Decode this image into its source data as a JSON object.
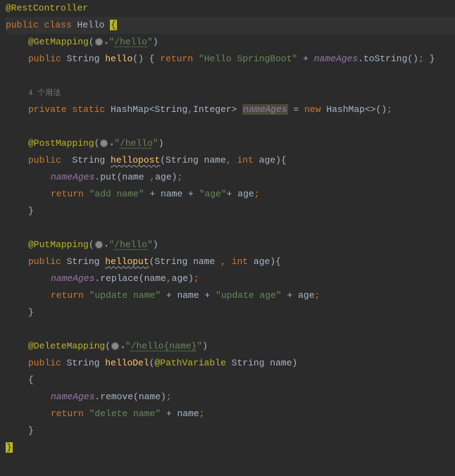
{
  "lines": {
    "l1": "@RestController",
    "l2a": "public",
    "l2b": "class",
    "l2c": "Hello",
    "l2d": "{",
    "l3a": "@GetMapping",
    "l3b": "(",
    "l3c": "\"",
    "l3d": "/hello",
    "l3e": "\"",
    "l3f": ")",
    "l4a": "public",
    "l4b": "String",
    "l4c": "hello",
    "l4d": "() { ",
    "l4e": "return",
    "l4f": "\"Hello SpringBoot\"",
    "l4g": " + ",
    "l4h": "nameAges",
    "l4i": ".toString()",
    "l4j": ";",
    "l4k": " }",
    "l5": "4 个用法",
    "l6a": "private",
    "l6b": "static",
    "l6c": "HashMap<String",
    "l6d": ",",
    "l6e": "Integer> ",
    "l6f": "nameAges",
    "l6g": " = ",
    "l6h": "new",
    "l6i": " HashMap<>()",
    "l6j": ";",
    "l7a": "@PostMapping",
    "l7b": "(",
    "l7c": "\"",
    "l7d": "/hello",
    "l7e": "\"",
    "l7f": ")",
    "l8a": "public",
    "l8b": "  String ",
    "l8c": "hellopost",
    "l8d": "(String name",
    "l8e": ",",
    "l8f": " ",
    "l8g": "int",
    "l8h": " age){",
    "l9a": "nameAges",
    "l9b": ".put(name ",
    "l9c": ",",
    "l9d": "age)",
    "l9e": ";",
    "l10a": "return",
    "l10b": "\"add name\"",
    "l10c": " + name + ",
    "l10d": "\"age\"",
    "l10e": "+ age",
    "l10f": ";",
    "l11": "}",
    "l12a": "@PutMapping",
    "l12b": "(",
    "l12c": "\"",
    "l12d": "/hello",
    "l12e": "\"",
    "l12f": ")",
    "l13a": "public",
    "l13b": " String ",
    "l13c": "helloput",
    "l13d": "(String name ",
    "l13e": ",",
    "l13f": " ",
    "l13g": "int",
    "l13h": " age){",
    "l14a": "nameAges",
    "l14b": ".replace(name",
    "l14c": ",",
    "l14d": "age)",
    "l14e": ";",
    "l15a": "return",
    "l15b": "\"update name\"",
    "l15c": " + name + ",
    "l15d": "\"update age\"",
    "l15e": " + age",
    "l15f": ";",
    "l16": "}",
    "l17a": "@DeleteMapping",
    "l17b": "(",
    "l17c": "\"",
    "l17d": "/hello{name}",
    "l17e": "\"",
    "l17f": ")",
    "l18a": "public",
    "l18b": " String ",
    "l18c": "helloDel",
    "l18d": "(",
    "l18e": "@PathVariable",
    "l18f": " String name)",
    "l19": "{",
    "l20a": "nameAges",
    "l20b": ".remove(name)",
    "l20c": ";",
    "l21a": "return",
    "l21b": "\"delete name\"",
    "l21c": " + name",
    "l21d": ";",
    "l22": "}",
    "l23": "}"
  }
}
